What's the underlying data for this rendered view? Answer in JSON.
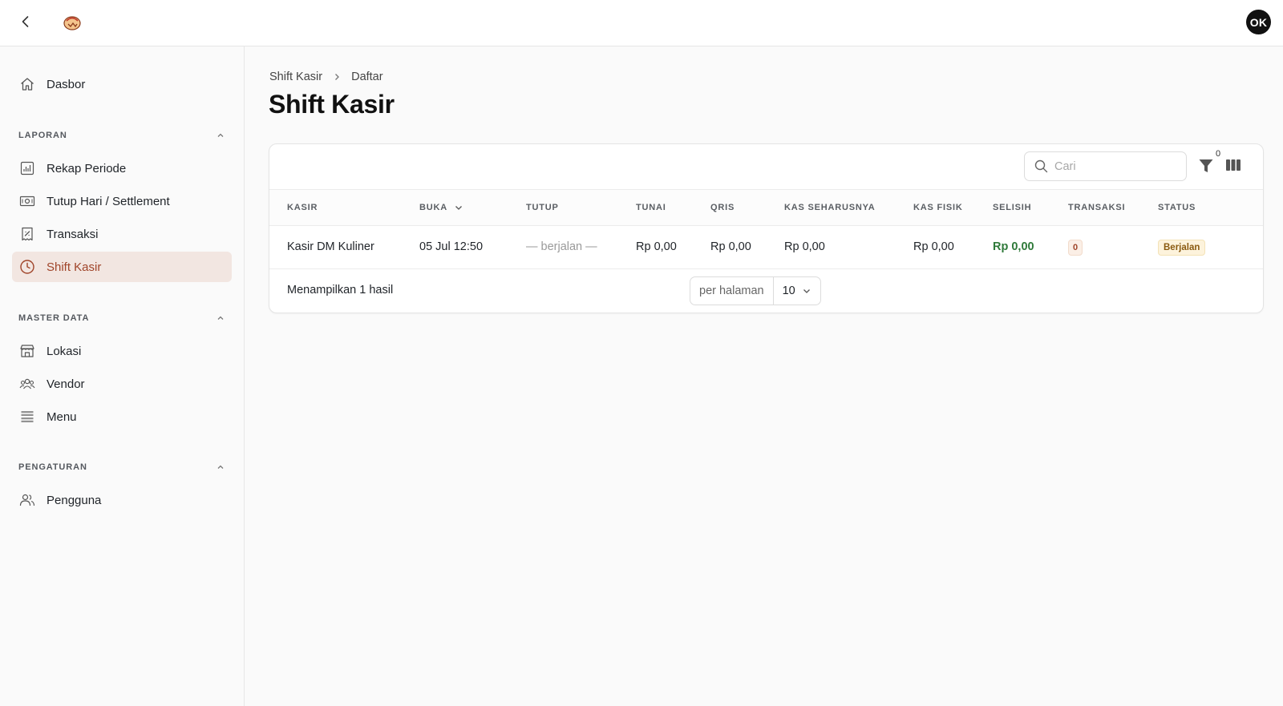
{
  "topbar": {
    "user_initials": "OK"
  },
  "sidebar": {
    "dashboard": "Dasbor",
    "sections": [
      {
        "title": "LAPORAN",
        "items": [
          "Rekap Periode",
          "Tutup Hari / Settlement",
          "Transaksi",
          "Shift Kasir"
        ]
      },
      {
        "title": "MASTER DATA",
        "items": [
          "Lokasi",
          "Vendor",
          "Menu"
        ]
      },
      {
        "title": "PENGATURAN",
        "items": [
          "Pengguna"
        ]
      }
    ],
    "active_item": "Shift Kasir"
  },
  "breadcrumb": {
    "parent": "Shift Kasir",
    "current": "Daftar"
  },
  "page_title": "Shift Kasir",
  "toolbar": {
    "search_placeholder": "Cari",
    "filter_count": "0",
    "filter_icon": "filter-icon",
    "columns_icon": "columns-icon"
  },
  "table": {
    "columns": [
      "KASIR",
      "BUKA",
      "TUTUP",
      "TUNAI",
      "QRIS",
      "KAS SEHARUSNYA",
      "KAS FISIK",
      "SELISIH",
      "TRANSAKSI",
      "STATUS"
    ],
    "sorted_column": "BUKA",
    "rows": [
      {
        "kasir": "Kasir DM Kuliner",
        "buka": "05 Jul 12:50",
        "tutup": "— berjalan —",
        "tunai": "Rp 0,00",
        "qris": "Rp 0,00",
        "kas_seharusnya": "Rp 0,00",
        "kas_fisik": "Rp 0,00",
        "selisih": "Rp 0,00",
        "transaksi": "0",
        "status": "Berjalan"
      }
    ]
  },
  "footer": {
    "result_text": "Menampilkan 1 hasil",
    "per_page_label": "per halaman",
    "per_page_value": "10"
  },
  "colors": {
    "accent": "#a0452a",
    "active_bg": "#f2e6e1",
    "positive": "#2f7a3a",
    "status_bg": "#fdf3dc"
  }
}
